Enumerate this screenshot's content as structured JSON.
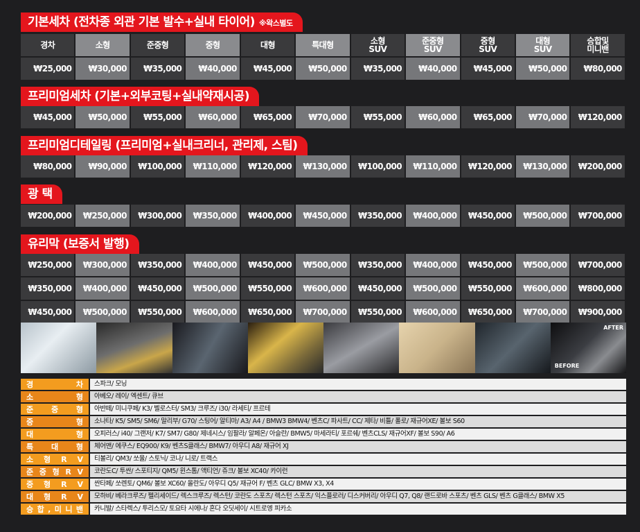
{
  "sections": [
    {
      "title": "기본세차 (전차종 외관 기본 발수+실내 타이어)",
      "note": "※왁스별도"
    },
    {
      "title": "프리미엄세차 (기본+외부코팅+실내약재시공)"
    },
    {
      "title": "프리미엄디테일링 (프리미엄+실내크리너, 관리제, 스팀)"
    },
    {
      "title": "광 택"
    },
    {
      "title": "유리막 (보증서 발행)"
    }
  ],
  "headers": [
    [
      "경차"
    ],
    [
      "소형"
    ],
    [
      "준중형"
    ],
    [
      "중형"
    ],
    [
      "대형"
    ],
    [
      "특대형"
    ],
    [
      "소형",
      "SUV"
    ],
    [
      "준중형",
      "SUV"
    ],
    [
      "중형",
      "SUV"
    ],
    [
      "대형",
      "SUV"
    ],
    [
      "승합및",
      "미니밴"
    ]
  ],
  "prices": {
    "basic": [
      "₩25,000",
      "₩30,000",
      "₩35,000",
      "₩40,000",
      "₩45,000",
      "₩50,000",
      "₩35,000",
      "₩40,000",
      "₩45,000",
      "₩50,000",
      "₩80,000"
    ],
    "premium": [
      "₩45,000",
      "₩50,000",
      "₩55,000",
      "₩60,000",
      "₩65,000",
      "₩70,000",
      "₩55,000",
      "₩60,000",
      "₩65,000",
      "₩70,000",
      "₩120,000"
    ],
    "detailing": [
      "₩80,000",
      "₩90,000",
      "₩100,000",
      "₩110,000",
      "₩120,000",
      "₩130,000",
      "₩100,000",
      "₩110,000",
      "₩120,000",
      "₩130,000",
      "₩200,000"
    ],
    "polish": [
      "₩200,000",
      "₩250,000",
      "₩300,000",
      "₩350,000",
      "₩400,000",
      "₩450,000",
      "₩350,000",
      "₩400,000",
      "₩450,000",
      "₩500,000",
      "₩700,000"
    ],
    "glass": [
      [
        "₩250,000",
        "₩300,000",
        "₩350,000",
        "₩400,000",
        "₩450,000",
        "₩500,000",
        "₩350,000",
        "₩400,000",
        "₩450,000",
        "₩500,000",
        "₩700,000"
      ],
      [
        "₩350,000",
        "₩400,000",
        "₩450,000",
        "₩500,000",
        "₩550,000",
        "₩600,000",
        "₩450,000",
        "₩500,000",
        "₩550,000",
        "₩600,000",
        "₩800,000"
      ],
      [
        "₩450,000",
        "₩500,000",
        "₩550,000",
        "₩600,000",
        "₩650,000",
        "₩700,000",
        "₩550,000",
        "₩600,000",
        "₩650,000",
        "₩700,000",
        "₩900,000"
      ]
    ]
  },
  "photo_labels": {
    "after": "AFTER",
    "before": "BEFORE"
  },
  "classes": [
    {
      "label": "경차",
      "cars": "스파크/ 모닝"
    },
    {
      "label": "소형",
      "cars": "아베오/ 레이/ 엑센트/ 큐브"
    },
    {
      "label": "준중형",
      "cars": "아반떼/ 미니쿠페/ K3/ 벨로스터/ SM3/ 크루즈/ i30/ 라세티/ 프르테"
    },
    {
      "label": "중형",
      "cars": "소나타/ K5/ SM5/ SM6/ 말리부/ G70/ 스팅어/ 알티마/ A3/ A4 / BMW3 BMW4/ 벤츠C/ 파사트/ CC/ 제타/ 비틀/ 폴로/ 재규어XE/ 볼보 S60"
    },
    {
      "label": "대형",
      "cars": "오피러스/ i40/ 그랜저/ K7/ SM7/ G80/ 제네시스/ 임팔라/ 알페온/ 아슬란/ BMW5/ 마세라티/ 포르쉐/ 벤츠CLS/ 재규어XF/ 볼보 S90/ A6"
    },
    {
      "label": "특대형",
      "cars": "체어맨/ 에쿠스/ EQ900/ K9/ 벤츠S클래스/ BMW7/ 아우디 A8/ 재규어 XJ"
    },
    {
      "label": "소형RV",
      "cars": "티볼리/ QM3/ 쏘울/ 스토닉/ 코나/ 니로/ 트랙스"
    },
    {
      "label": "준중형RV",
      "cars": "코란도C/ 투싼/ 스포티지/ QM5/ 윈스톰/ 액티언/ 쥬크/ 볼보 XC40/ 카이런"
    },
    {
      "label": "중형RV",
      "cars": "싼타페/ 쏘렌토/ QM6/ 볼보 XC60/ 올란도/ 아우디 Q5/ 재규어 F/ 벤츠 GLC/  BMW X3, X4"
    },
    {
      "label": "대형RV",
      "cars": "모하비/ 베라크루즈/ 펠리세이드/ 렉스크루즈/ 렉스턴/ 코란도 스포츠/ 렉스턴 스포츠/ 익스플로러/ 디스커버리/ 아우디 Q7, Q8/ 랜드로바 스포츠/ 벤츠 GLS/ 벤츠 G클래스/ BMW X5"
    },
    {
      "label": "승합,미니밴",
      "cars": "카니발/ 스타렉스/ 투리스모/ 토요타 시에나/ 혼다 오딧세이/ 시트로엥 피카소"
    }
  ]
}
